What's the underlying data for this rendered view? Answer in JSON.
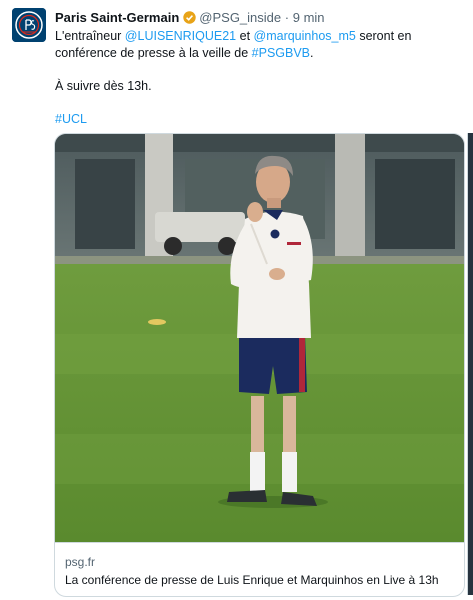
{
  "author": {
    "name": "Paris Saint-Germain",
    "handle": "@PSG_inside",
    "separator": "·",
    "time": "9 min",
    "verified_color": "#e8a317",
    "avatar_bg": "#004170",
    "avatar_logo_text": "PARIS SAINT-GERMAIN"
  },
  "tweet": {
    "line1_prefix": "L'entraîneur ",
    "mention1": "@LUISENRIQUE21",
    "line1_mid": " et ",
    "mention2": "@marquinhos_m5",
    "line1_suffix": " seront en conférence de presse à la veille de ",
    "hashtag1": "#PSGBVB",
    "line1_end": ".",
    "line2": "À suivre dès 13h.",
    "hashtag2": "#UCL",
    "link_color": "#1d9bf0"
  },
  "card": {
    "image": "photo-coach-on-training-pitch",
    "domain": "psg.fr",
    "title": "La conférence de presse de Luis Enrique et Marquinhos en Live à 13h"
  }
}
